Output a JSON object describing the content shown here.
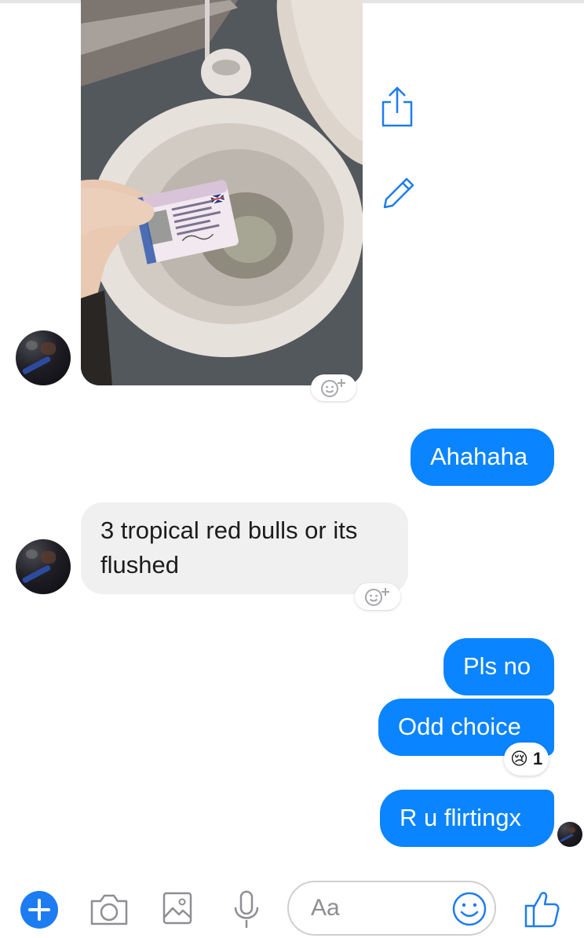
{
  "colors": {
    "accent": "#0a84ff",
    "incoming_bubble": "#f0f0f1",
    "icon_blue": "#1d7cf2"
  },
  "messages": {
    "photo": {
      "type": "image",
      "description_icon": "photo-message"
    },
    "ahahaha": "Ahahaha",
    "incoming_text_line1": "3 tropical red bulls or its",
    "incoming_text_line2": "flushed",
    "pls_no": "Pls no",
    "odd_choice": "Odd choice",
    "odd_choice_reaction_emoji": "😢",
    "odd_choice_reaction_count": "1",
    "r_u_flirting": "R u flirtingx"
  },
  "photo_card": {
    "licence_title": "DRIVING LICENCE",
    "signature": "Scrawled"
  },
  "composer": {
    "placeholder": "Aa",
    "icons": [
      "plus-icon",
      "camera-icon",
      "gallery-icon",
      "microphone-icon",
      "emoji-icon",
      "thumbs-up-icon"
    ]
  },
  "side_actions": [
    "share-icon",
    "edit-icon"
  ]
}
